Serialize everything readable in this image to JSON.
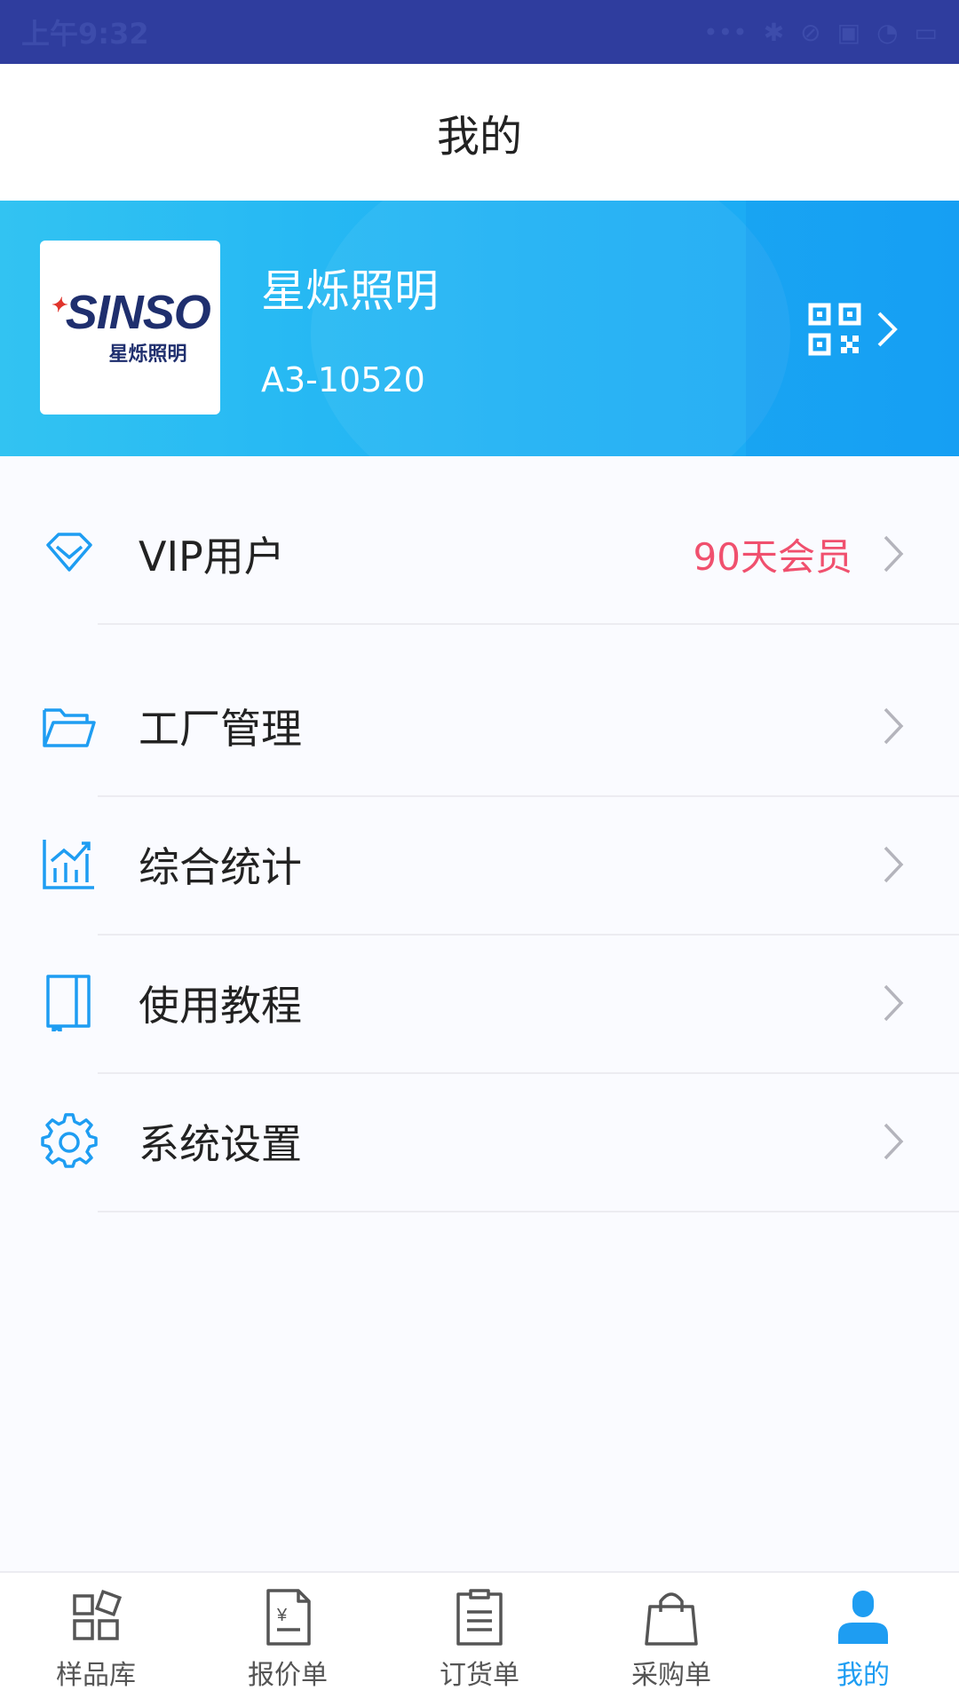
{
  "status_bar": {
    "time": "上午9:32"
  },
  "header": {
    "title": "我的"
  },
  "profile": {
    "logo_text": "SINSO",
    "logo_sub": "星烁照明",
    "company_name": "星烁照明",
    "code": "A3-10520"
  },
  "menu": {
    "items": [
      {
        "label": "VIP用户",
        "value": "90天会员",
        "icon": "diamond-icon"
      },
      {
        "label": "工厂管理",
        "icon": "folder-icon"
      },
      {
        "label": "综合统计",
        "icon": "chart-icon"
      },
      {
        "label": "使用教程",
        "icon": "book-icon"
      },
      {
        "label": "系统设置",
        "icon": "gear-icon"
      }
    ]
  },
  "bottom_nav": {
    "items": [
      {
        "label": "样品库",
        "icon": "grid-icon"
      },
      {
        "label": "报价单",
        "icon": "quote-doc-icon"
      },
      {
        "label": "订货单",
        "icon": "clipboard-icon"
      },
      {
        "label": "采购单",
        "icon": "shopping-bag-icon"
      },
      {
        "label": "我的",
        "icon": "user-icon",
        "active": true
      }
    ]
  },
  "colors": {
    "status_bar": "#2f3d9e",
    "banner": "#1eb1f4",
    "accent": "#1e9df2",
    "vip_value": "#f0506e"
  }
}
